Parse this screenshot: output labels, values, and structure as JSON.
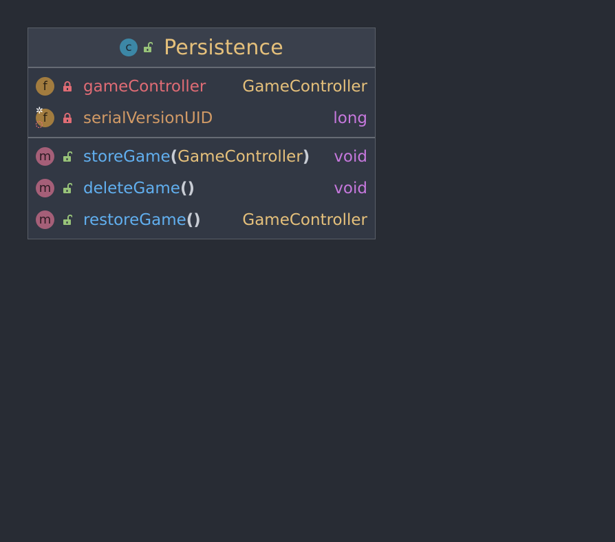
{
  "class": {
    "name": "Persistence",
    "kind_badge": "c",
    "visibility": "public"
  },
  "fields": [
    {
      "badge": "f",
      "visibility": "private",
      "name": "gameController",
      "type": "GameController",
      "static": false
    },
    {
      "badge": "f",
      "visibility": "private",
      "name": "serialVersionUID",
      "type": "long",
      "static": true
    }
  ],
  "methods": [
    {
      "badge": "m",
      "visibility": "public",
      "name": "storeGame",
      "open_paren": "(",
      "params": "GameController",
      "close_paren": ")",
      "return_type": "void"
    },
    {
      "badge": "m",
      "visibility": "public",
      "name": "deleteGame",
      "open_paren": "(",
      "params": "",
      "close_paren": ")",
      "return_type": "void"
    },
    {
      "badge": "m",
      "visibility": "public",
      "name": "restoreGame",
      "open_paren": "(",
      "params": "",
      "close_paren": ")",
      "return_type": "GameController"
    }
  ],
  "colors": {
    "background": "#282c34",
    "class_badge": "#3c87a6",
    "field_badge": "#a27c3f",
    "method_badge": "#a55f78",
    "private_lock": "#e06c75",
    "public_lock": "#98c379",
    "class_name": "#e5c07b",
    "field_name": "#e06c75",
    "static_field_name": "#d19a66",
    "method_name": "#61afef",
    "class_type": "#e5c07b",
    "primitive_type": "#c678dd"
  },
  "icons": {
    "class": "class-icon",
    "field": "field-icon",
    "method": "method-icon",
    "private": "private-lock-icon",
    "public": "public-unlock-icon"
  }
}
